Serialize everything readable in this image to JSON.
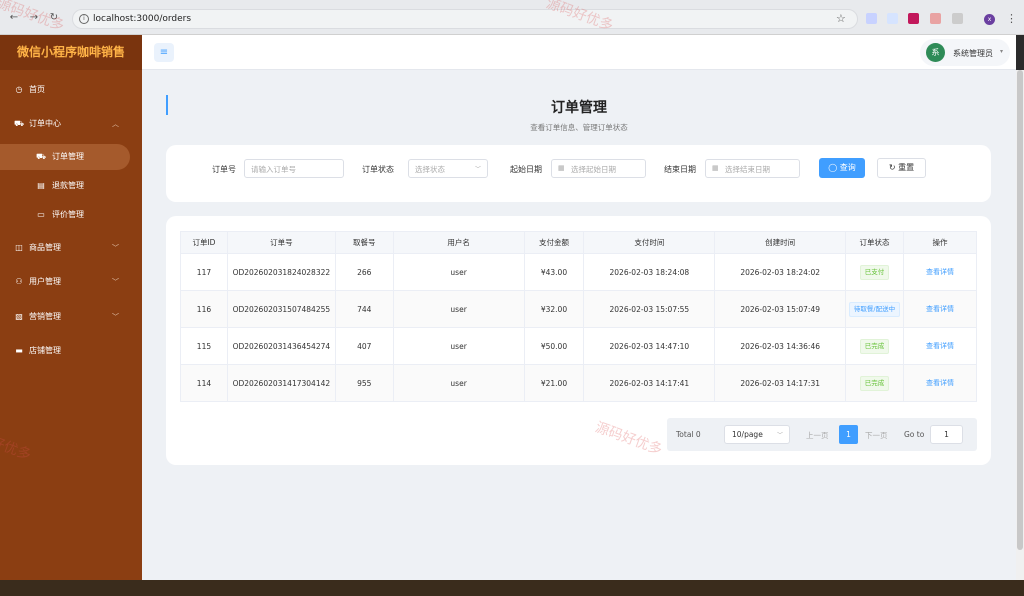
{
  "browser": {
    "url": "localhost:3000/orders",
    "profile_initial": "x"
  },
  "sidebar": {
    "brand": "微信小程序咖啡销售",
    "items": [
      {
        "label": "首页",
        "icon": "dashboard-icon"
      },
      {
        "label": "订单中心",
        "icon": "cart-icon",
        "expanded": true
      },
      {
        "label": "订单管理",
        "icon": "cart-icon",
        "active": true
      },
      {
        "label": "退款管理",
        "icon": "refund-icon"
      },
      {
        "label": "评价管理",
        "icon": "comment-icon"
      },
      {
        "label": "商品管理",
        "icon": "bag-icon"
      },
      {
        "label": "用户管理",
        "icon": "user-icon"
      },
      {
        "label": "营销管理",
        "icon": "chart-icon"
      },
      {
        "label": "店铺管理",
        "icon": "store-icon"
      }
    ]
  },
  "header": {
    "user_initial": "系",
    "user_name": "系统管理员"
  },
  "page": {
    "title": "订单管理",
    "subtitle": "查看订单信息、管理订单状态"
  },
  "filters": {
    "order_no_label": "订单号",
    "order_no_placeholder": "请输入订单号",
    "status_label": "订单状态",
    "status_placeholder": "选择状态",
    "start_label": "起始日期",
    "start_placeholder": "选择起始日期",
    "end_label": "结束日期",
    "end_placeholder": "选择结束日期",
    "query_label": "查询",
    "reset_label": "重置"
  },
  "table": {
    "headers": [
      "订单ID",
      "订单号",
      "取餐号",
      "用户名",
      "支付金额",
      "支付时间",
      "创建时间",
      "订单状态",
      "操作"
    ],
    "rows": [
      {
        "id": "117",
        "order_no": "OD202602031824028322",
        "pickup": "266",
        "user": "user",
        "amount": "¥43.00",
        "paid_at": "2026-02-03 18:24:08",
        "created_at": "2026-02-03 18:24:02",
        "status": "已支付",
        "status_color": "green",
        "action": "查看详情"
      },
      {
        "id": "116",
        "order_no": "OD202602031507484255",
        "pickup": "744",
        "user": "user",
        "amount": "¥32.00",
        "paid_at": "2026-02-03 15:07:55",
        "created_at": "2026-02-03 15:07:49",
        "status": "待取餐/配送中",
        "status_color": "blue",
        "action": "查看详情"
      },
      {
        "id": "115",
        "order_no": "OD202602031436454274",
        "pickup": "407",
        "user": "user",
        "amount": "¥50.00",
        "paid_at": "2026-02-03 14:47:10",
        "created_at": "2026-02-03 14:36:46",
        "status": "已完成",
        "status_color": "green",
        "action": "查看详情"
      },
      {
        "id": "114",
        "order_no": "OD202602031417304142",
        "pickup": "955",
        "user": "user",
        "amount": "¥21.00",
        "paid_at": "2026-02-03 14:17:41",
        "created_at": "2026-02-03 14:17:31",
        "status": "已完成",
        "status_color": "green",
        "action": "查看详情"
      }
    ]
  },
  "pagination": {
    "total": "Total 0",
    "page_size": "10/page",
    "prev": "上一页",
    "current": "1",
    "next": "下一页",
    "goto_label": "Go to",
    "goto_value": "1"
  },
  "watermarks": [
    "源码好优多",
    "源码好优多",
    "好优多",
    "源码好优多"
  ]
}
